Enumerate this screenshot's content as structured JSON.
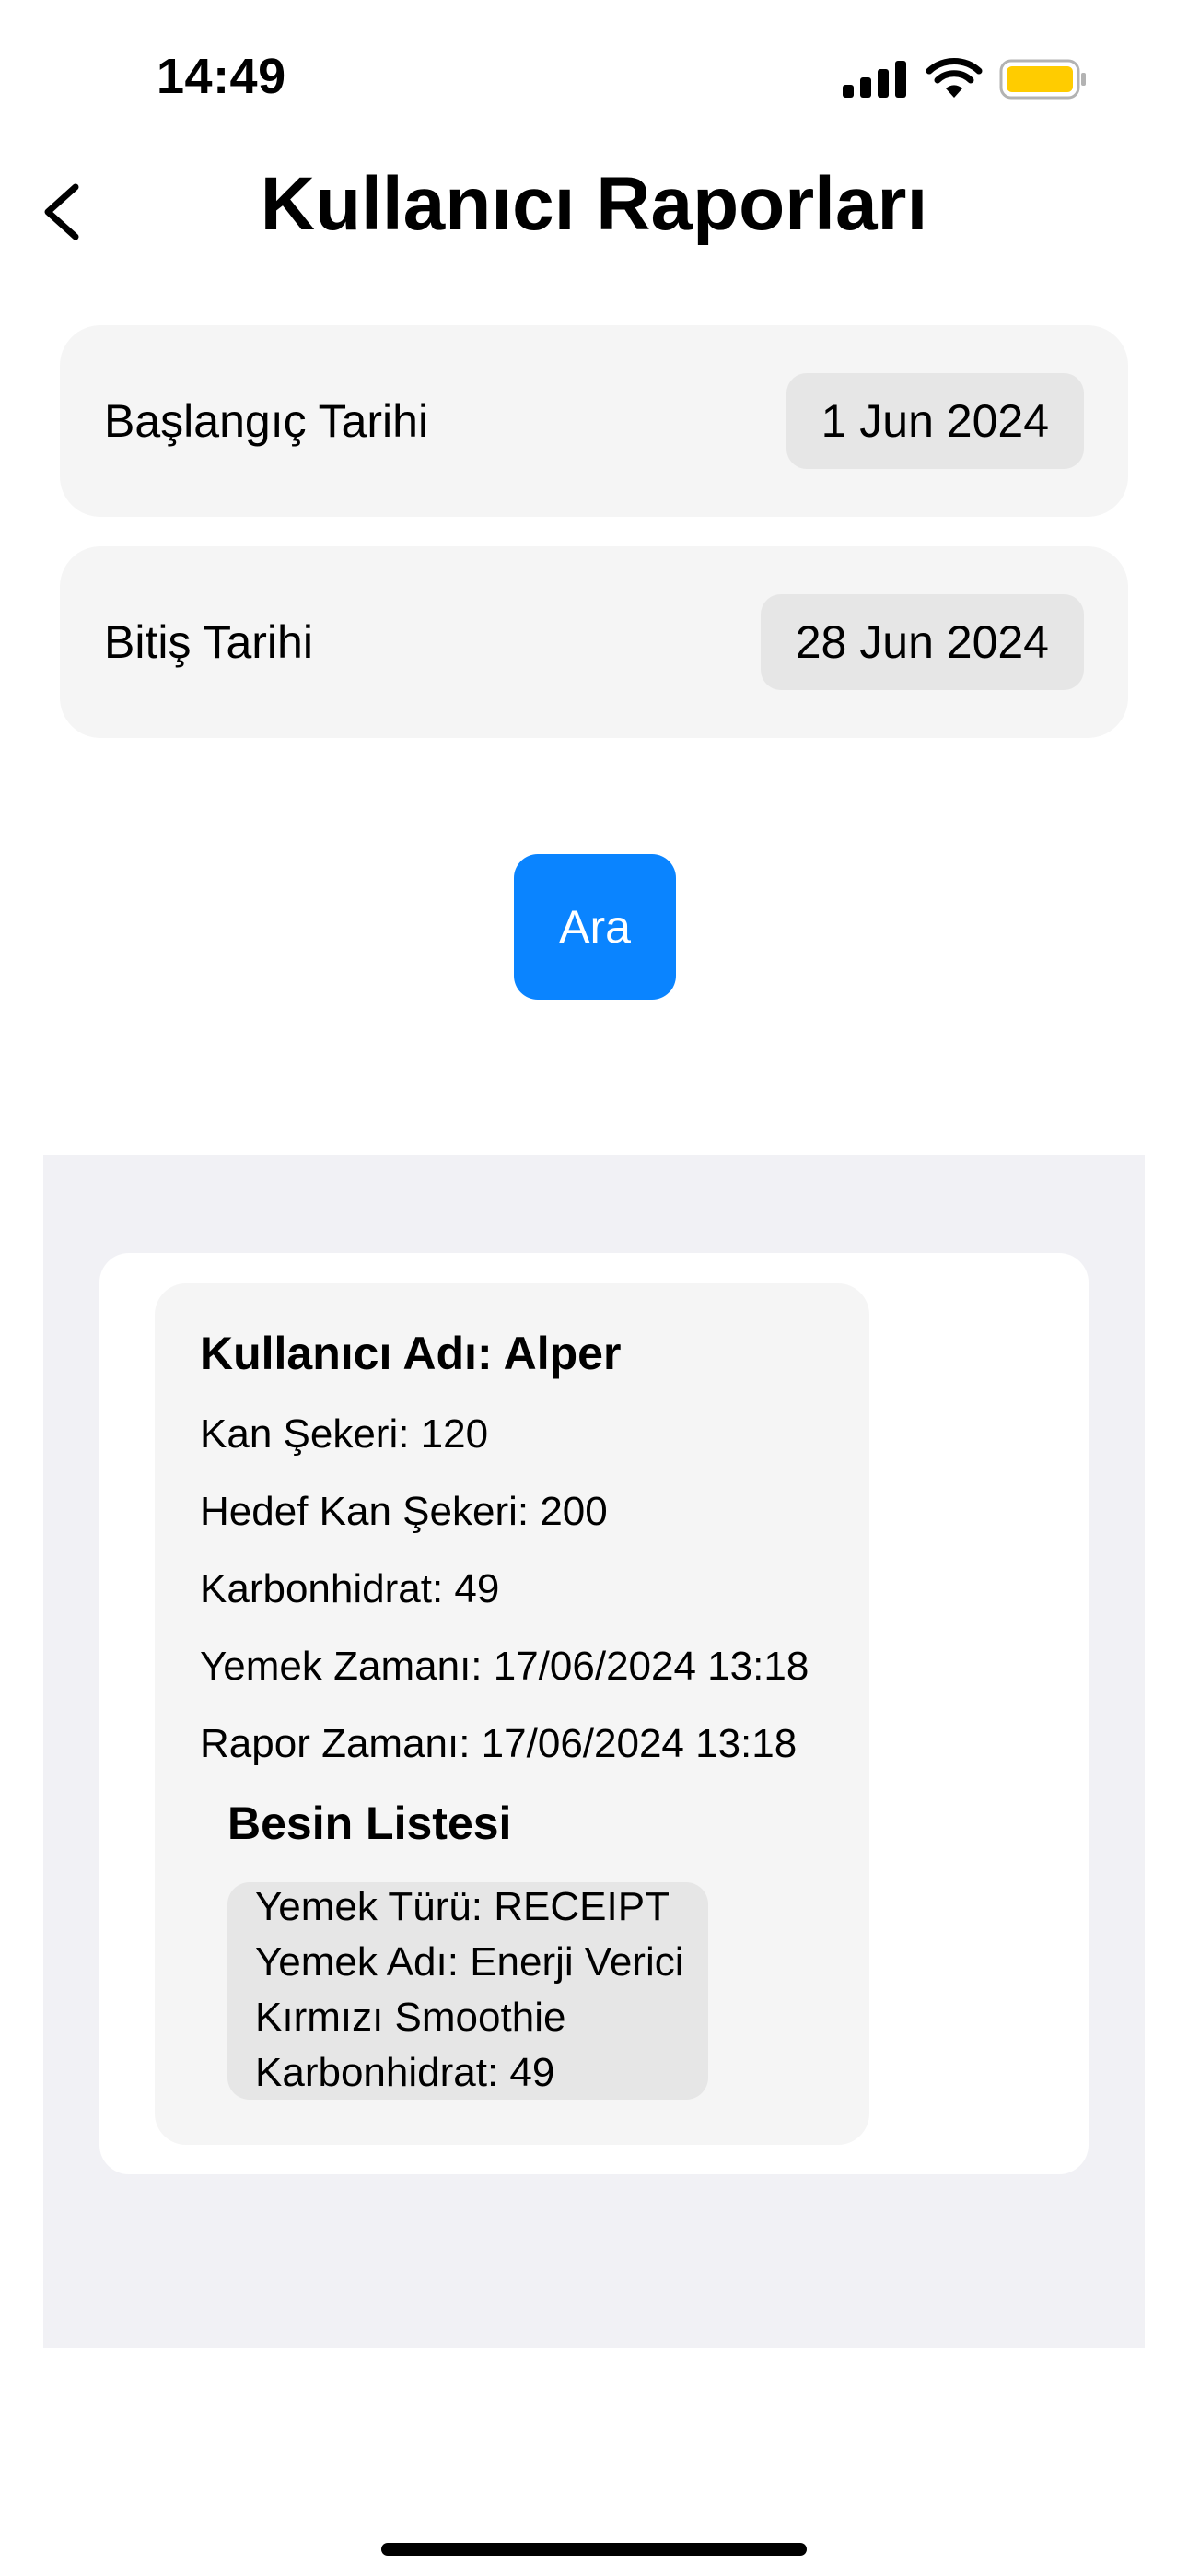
{
  "status_bar": {
    "time": "14:49",
    "battery_color": "#ffcc00"
  },
  "nav": {
    "title": "Kullanıcı Raporları",
    "back_icon": "chevron-left-icon"
  },
  "filters": {
    "start": {
      "label": "Başlangıç Tarihi",
      "value": "1 Jun 2024"
    },
    "end": {
      "label": "Bitiş Tarihi",
      "value": "28 Jun 2024"
    }
  },
  "search_button": {
    "label": "Ara",
    "color": "#0a84ff"
  },
  "report": {
    "username": "Kullanıcı Adı: Alper",
    "blood_sugar": "Kan Şekeri: 120",
    "target_blood_sugar": "Hedef Kan Şekeri: 200",
    "carbs": "Karbonhidrat: 49",
    "meal_time": "Yemek Zamanı: 17/06/2024 13:18",
    "report_time": "Rapor Zamanı: 17/06/2024 13:18",
    "food_list_title": "Besin Listesi",
    "food_items": [
      {
        "type": "Yemek Türü: RECEIPT",
        "name_line1": "Yemek Adı: Enerji Verici",
        "name_line2": "Kırmızı Smoothie",
        "carbs": "Karbonhidrat: 49"
      }
    ]
  }
}
